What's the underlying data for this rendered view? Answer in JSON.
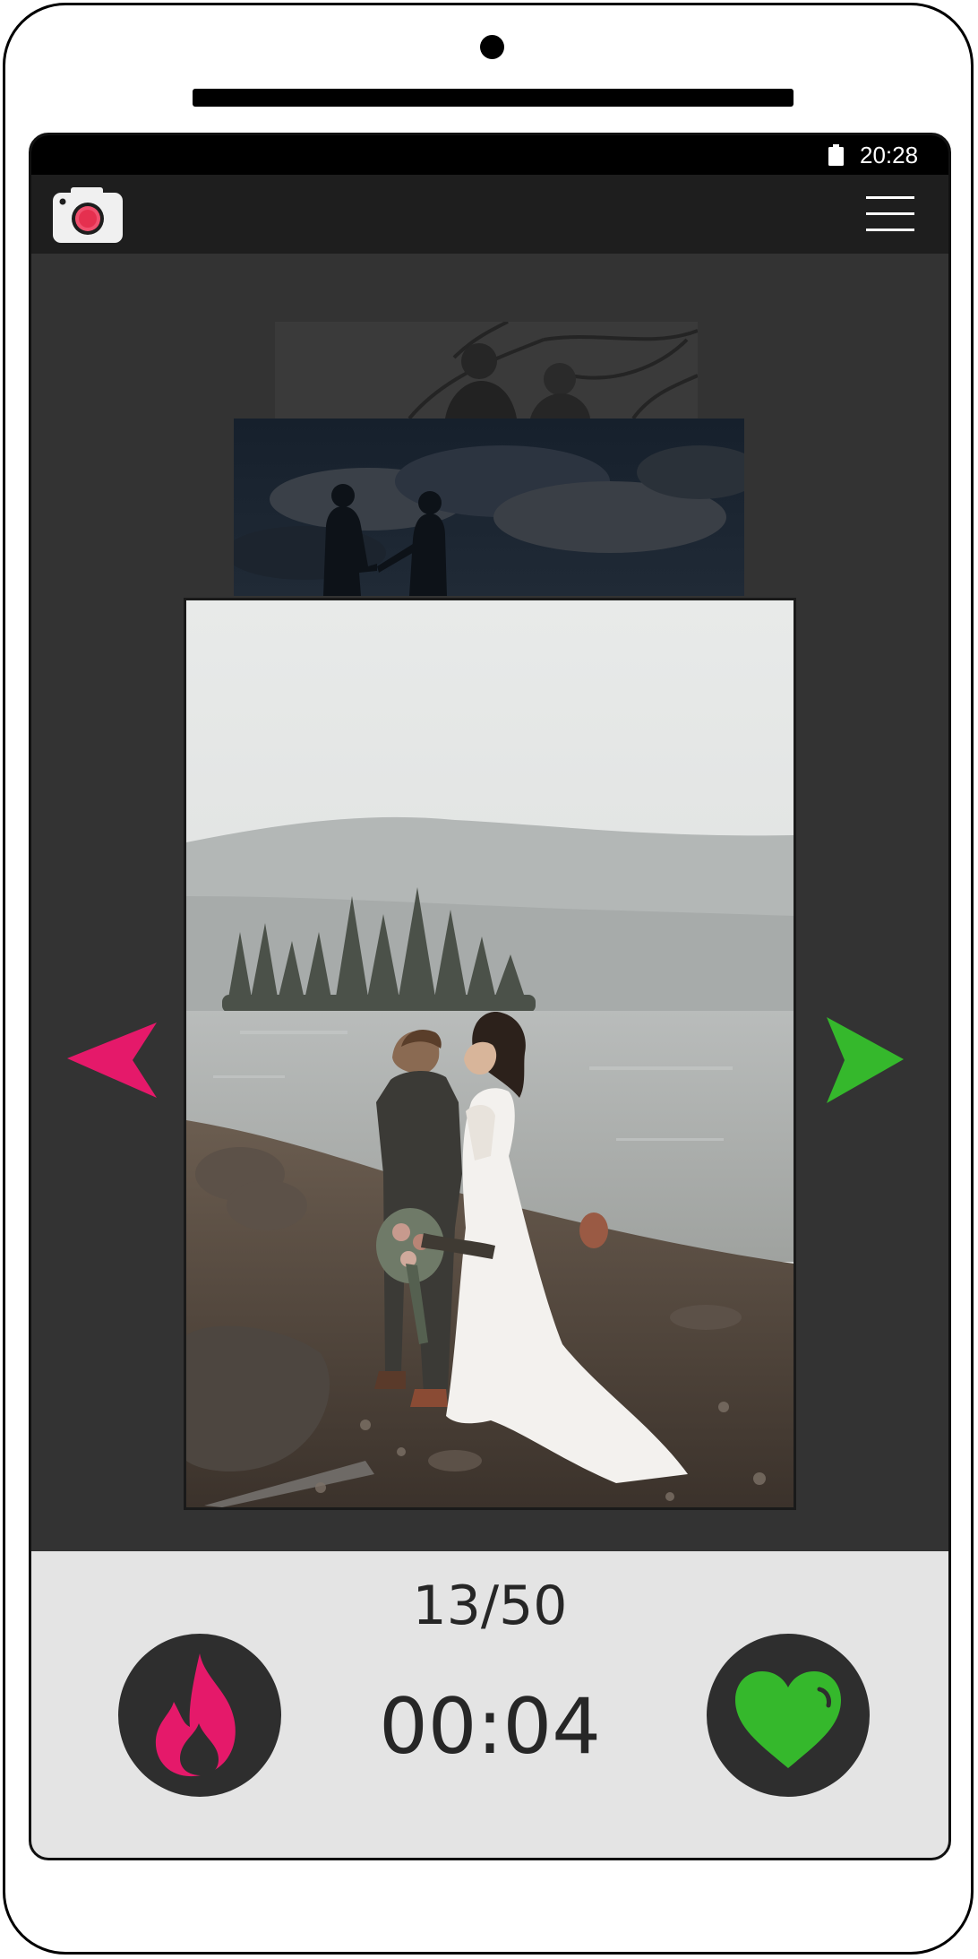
{
  "status_bar": {
    "time": "20:28",
    "battery_icon": "battery-full-icon"
  },
  "app_bar": {
    "logo_icon": "camera-logo-icon",
    "menu_icon": "hamburger-menu-icon"
  },
  "gallery": {
    "prev_icon": "arrow-left-icon",
    "next_icon": "arrow-right-icon",
    "photos": [
      {
        "name": "couple-under-tree-photo",
        "position": "back"
      },
      {
        "name": "silhouette-couple-photo",
        "position": "middle"
      },
      {
        "name": "couple-kissing-lakeside-photo",
        "position": "front"
      }
    ]
  },
  "bottom_panel": {
    "counter": "13/50",
    "timer": "00:04",
    "left_button_icon": "fire-icon",
    "right_button_icon": "heart-icon"
  },
  "colors": {
    "accent_pink": "#e5196a",
    "accent_green": "#35b82c",
    "screen_bg": "#333333",
    "panel_bg": "#e4e4e4"
  }
}
